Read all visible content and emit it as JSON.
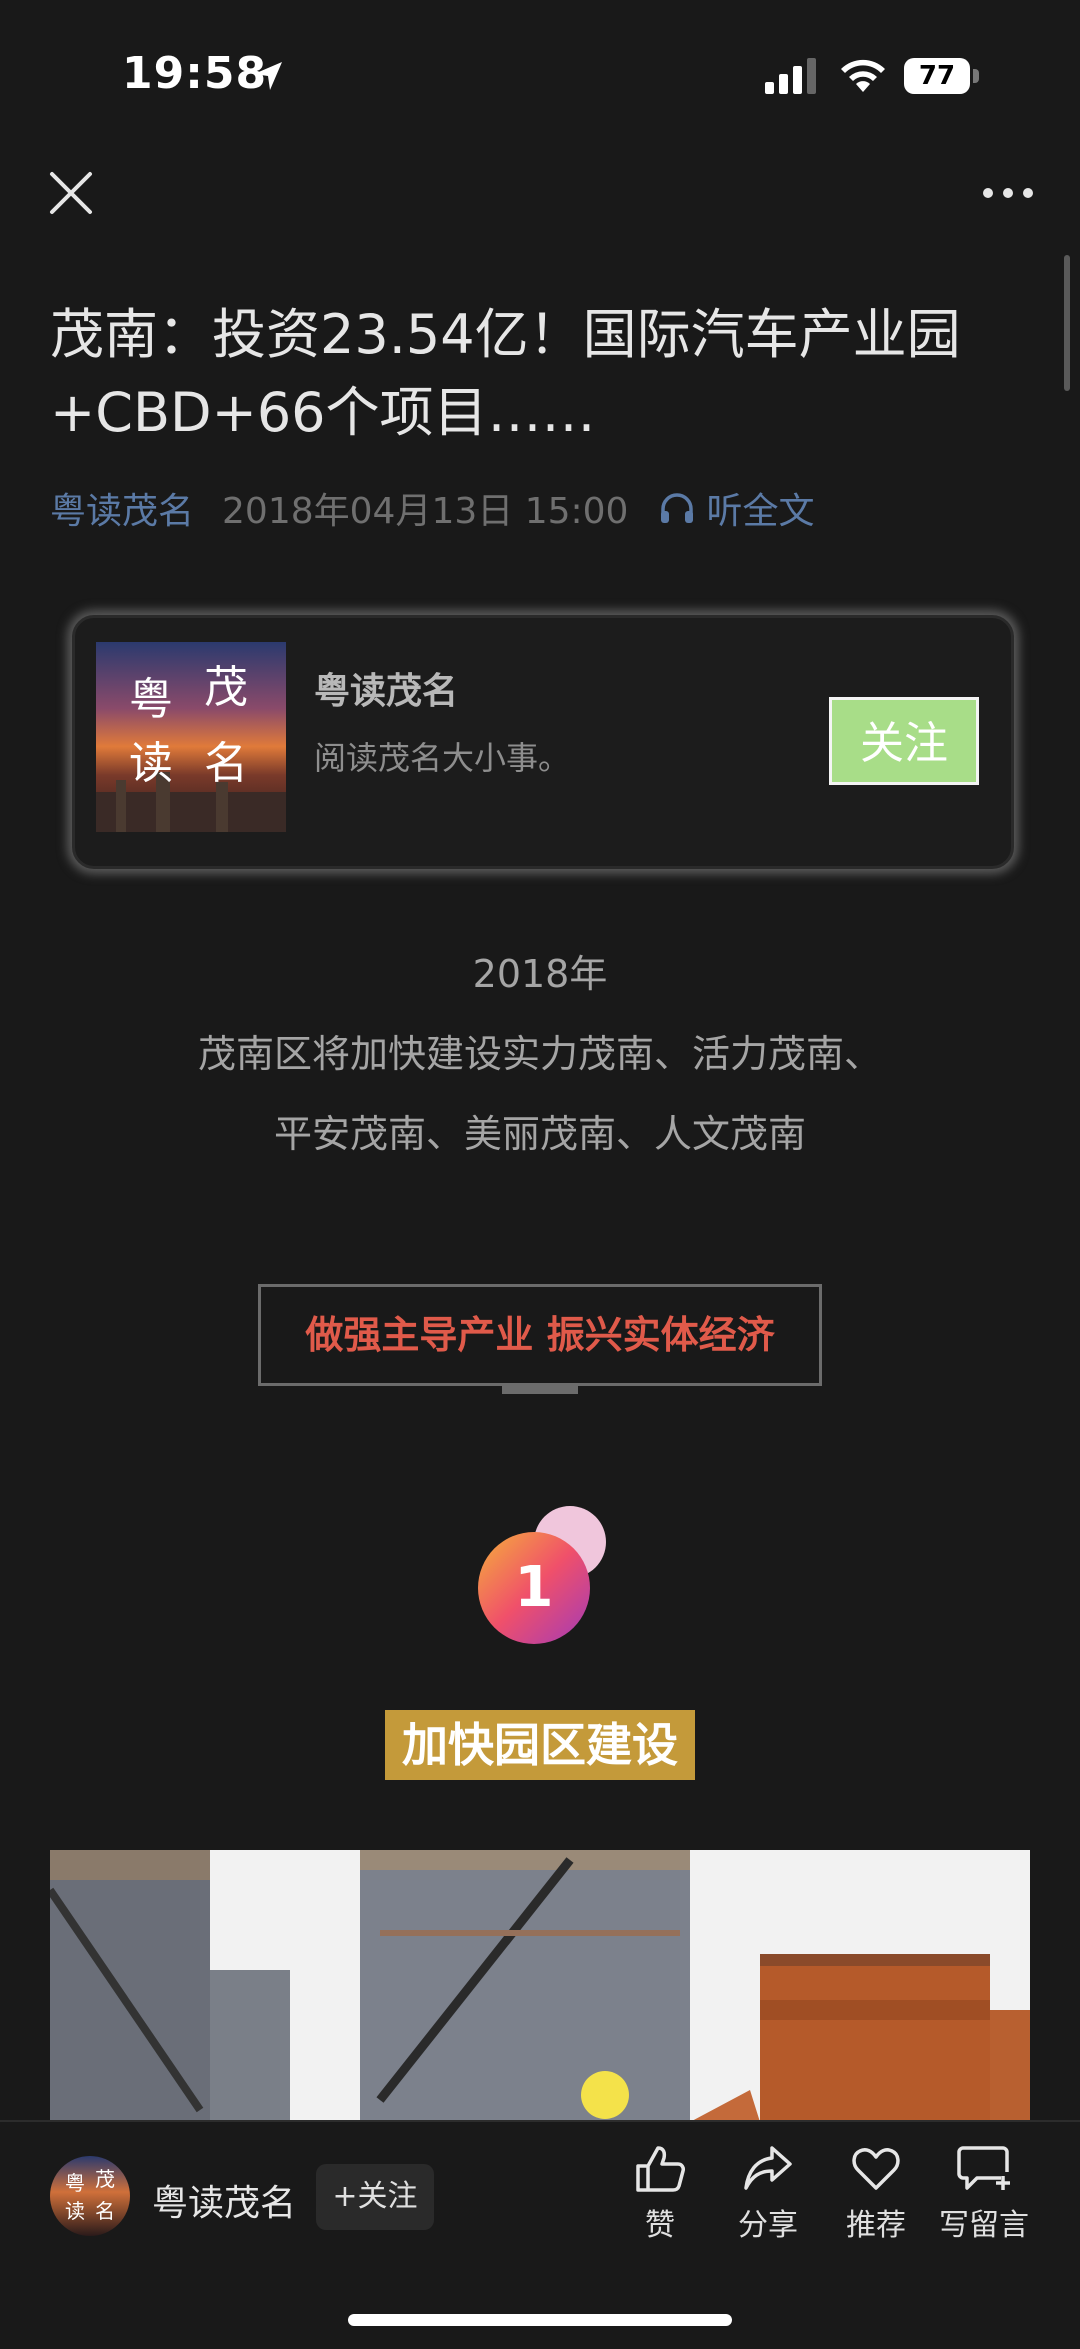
{
  "status_bar": {
    "time": "19:58",
    "battery": "77"
  },
  "article": {
    "title": "茂南：投资23.54亿！国际汽车产业园+CBD+66个项目……",
    "account": "粤读茂名",
    "date": "2018年04月13日 15:00",
    "listen_label": "听全文"
  },
  "card": {
    "avatar_text": [
      "粤",
      "茂",
      "读",
      "名"
    ],
    "name": "粤读茂名",
    "description": "阅读茂名大小事。",
    "follow_label": "关注"
  },
  "intro": {
    "line1": "2018年",
    "line2": "茂南区将加快建设实力茂南、活力茂南、",
    "line3": "平安茂南、美丽茂南、人文茂南"
  },
  "section": {
    "frame_text": "做强主导产业 振兴实体经济",
    "badge_number": "1",
    "heading": "加快园区建设"
  },
  "bottom_bar": {
    "account": "粤读茂名",
    "follow_label": "+关注",
    "actions": [
      {
        "icon": "thumbs-up-icon",
        "label": "赞"
      },
      {
        "icon": "share-icon",
        "label": "分享"
      },
      {
        "icon": "heart-icon",
        "label": "推荐"
      },
      {
        "icon": "comment-icon",
        "label": "写留言"
      }
    ]
  },
  "colors": {
    "background": "#191919",
    "link": "#5b7aa6",
    "follow_button": "#a8dd88",
    "frame_text": "#e05a4a",
    "heading_bg": "#c49a3a"
  }
}
